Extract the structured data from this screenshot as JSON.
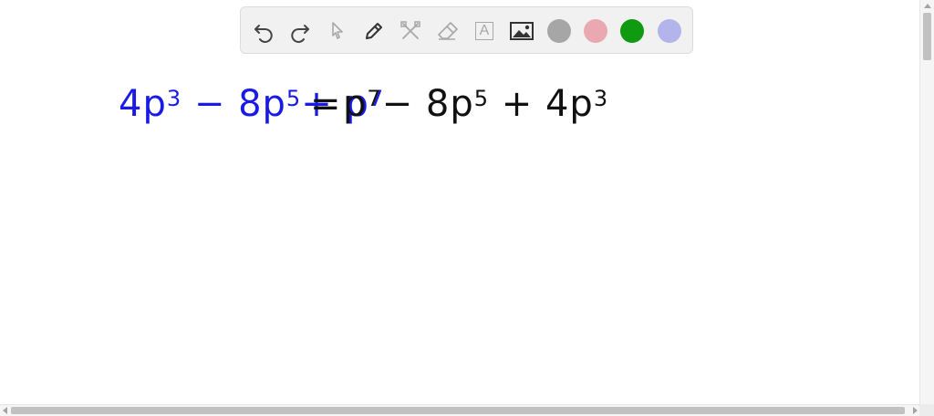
{
  "toolbar": {
    "tools": [
      {
        "name": "undo-icon",
        "label": ""
      },
      {
        "name": "redo-icon",
        "label": ""
      },
      {
        "name": "select-pointer-icon",
        "label": ""
      },
      {
        "name": "pen-icon",
        "label": ""
      },
      {
        "name": "tools-icon",
        "label": ""
      },
      {
        "name": "eraser-icon",
        "label": ""
      },
      {
        "name": "text-icon",
        "label": "A"
      },
      {
        "name": "image-icon",
        "label": ""
      }
    ],
    "colors": [
      "#a6a6a6",
      "#eaa9b0",
      "#0f9a12",
      "#b4b4ec"
    ]
  },
  "equation": {
    "lhs": {
      "color": "#1a1ae6",
      "t1_coef": "4p",
      "t1_exp": "3",
      "op1": "−",
      "t2_coef": "8p",
      "t2_exp": "5",
      "op2": "+",
      "t3_coef": "p",
      "t3_exp": "7"
    },
    "equals": "=",
    "rhs": {
      "color": "#111111",
      "t1_coef": "p",
      "t1_exp": "7",
      "op1": "−",
      "t2_coef": "8p",
      "t2_exp": "5",
      "op2": "+",
      "t3_coef": "4p",
      "t3_exp": "3"
    }
  }
}
